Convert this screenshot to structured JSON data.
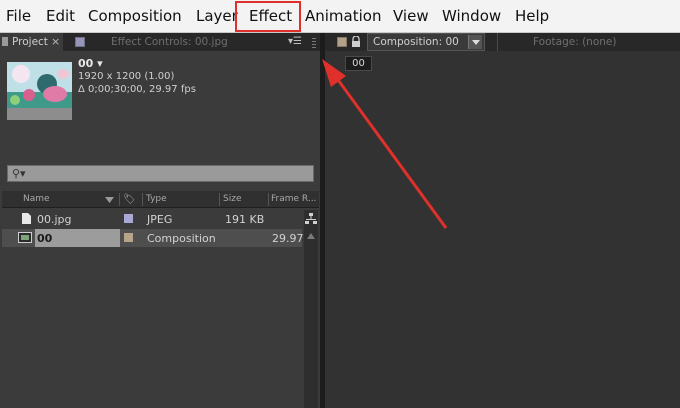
{
  "menu": {
    "items": [
      "File",
      "Edit",
      "Composition",
      "Layer",
      "Effect",
      "Animation",
      "View",
      "Window",
      "Help"
    ],
    "highlighted": "Effect"
  },
  "project_panel": {
    "tab_label": "Project",
    "effect_controls_tab": "Effect Controls: 00.jpg",
    "selected_item": {
      "name": "00 ▾",
      "resolution": "1920 x 1200 (1.00)",
      "duration": "Δ 0;00;30;00, 29.97 fps"
    },
    "search": {
      "icon": "search-icon",
      "placeholder": ""
    },
    "columns": [
      "Name",
      "Type",
      "Size",
      "Frame R..."
    ],
    "rows": [
      {
        "name": "00.jpg",
        "icon": "image-file-icon",
        "label_color": "#a9a9d8",
        "type": "JPEG",
        "size": "191 KB",
        "frame_rate": ""
      },
      {
        "name": "00",
        "icon": "composition-icon",
        "label_color": "#b7a58b",
        "type": "Composition",
        "size": "",
        "frame_rate": "29.97"
      }
    ]
  },
  "composition_panel": {
    "tab_label": "Composition: 00",
    "footage_tab": "Footage: (none)",
    "comp_name": "00"
  },
  "colors": {
    "annotation_red": "#e0302b",
    "panel_bg": "#3c3b3c"
  }
}
